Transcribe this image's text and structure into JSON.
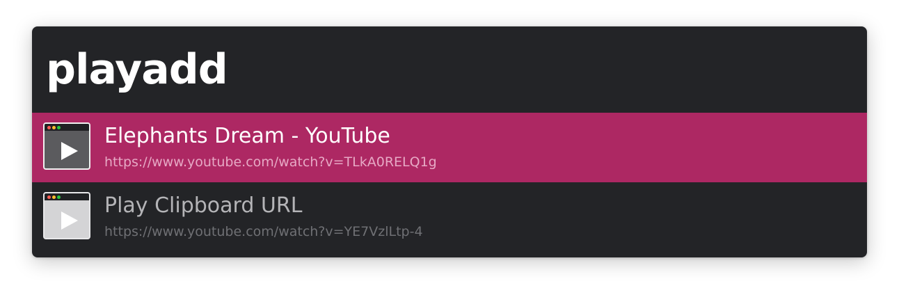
{
  "search": {
    "query": "playadd"
  },
  "results": [
    {
      "title": "Elephants Dream - YouTube",
      "subtitle": "https://www.youtube.com/watch?v=TLkA0RELQ1g",
      "icon": "video-window-play-icon",
      "selected": true
    },
    {
      "title": "Play Clipboard URL",
      "subtitle": "https://www.youtube.com/watch?v=YE7VzlLtp-4",
      "icon": "video-window-play-icon",
      "selected": false
    }
  ],
  "colors": {
    "background": "#232427",
    "selected_row": "#ad2863",
    "query_text": "#ffffff",
    "selected_subtitle": "#e7a9c5",
    "unselected_title": "#b4b4b7",
    "unselected_subtitle": "#6f7074"
  }
}
